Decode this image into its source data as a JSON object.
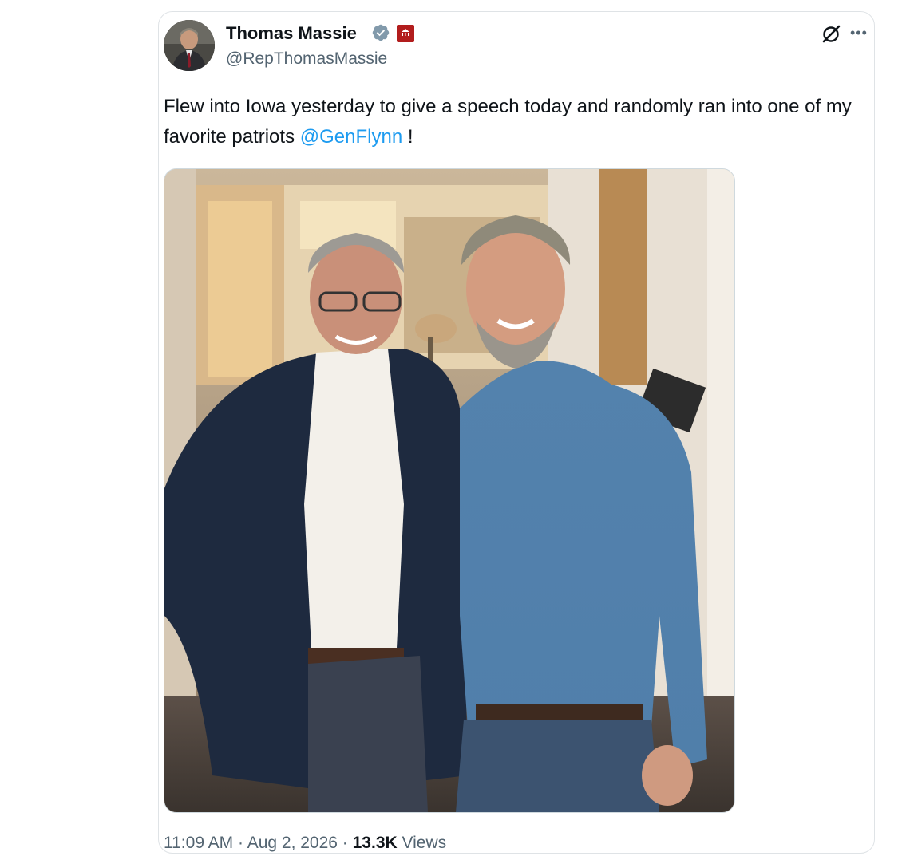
{
  "author": {
    "display_name": "Thomas Massie",
    "handle": "@RepThomasMassie"
  },
  "icons": {
    "verified": "verified-badge-icon",
    "affiliation": "government-affiliation-badge-icon",
    "grok": "grok-icon",
    "more": "more-options-icon"
  },
  "colors": {
    "accent": "#1d9bf0",
    "verified_badge": "#829aab",
    "affiliation_badge": "#b21d1d"
  },
  "tweet": {
    "text_before": "Flew into Iowa yesterday to give a speech today and randomly ran into one of my favorite patriots ",
    "mention": "@GenFlynn",
    "text_after": " !"
  },
  "meta": {
    "time": "11:09 AM",
    "sep1": " · ",
    "date": "Aug 2, 2026",
    "sep2": " · ",
    "views_count": "13.3K",
    "views_label": " Views"
  }
}
